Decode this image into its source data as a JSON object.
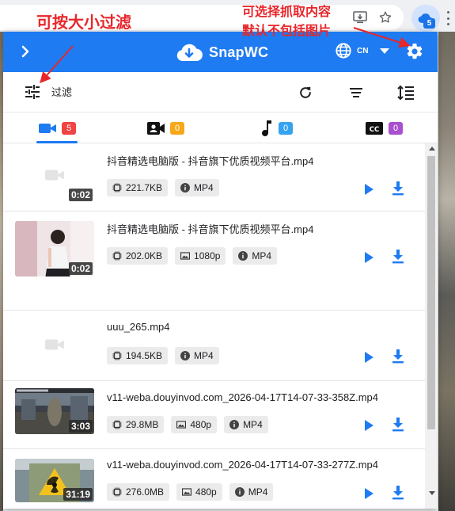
{
  "annotations": {
    "filter_note": "可按大小过滤",
    "settings_note_line1": "可选择抓取内容",
    "settings_note_line2": "默认不包括图片"
  },
  "extension_badge": "5",
  "header": {
    "app_name": "SnapWC",
    "language": "CN",
    "brand_color": "#1e7bf2"
  },
  "toolbar": {
    "filter_label": "过滤"
  },
  "tabs": [
    {
      "name": "video",
      "icon": "video-camera-icon",
      "count": "5",
      "badge_color": "#f04343"
    },
    {
      "name": "live",
      "icon": "live-camera-icon",
      "count": "0",
      "badge_color": "#f7a818"
    },
    {
      "name": "audio",
      "icon": "music-note-icon",
      "count": "0",
      "badge_color": "#35a3f0"
    },
    {
      "name": "subtitle",
      "icon": "closed-caption-icon",
      "count": "0",
      "badge_color": "#a94fd0"
    }
  ],
  "items": [
    {
      "filename": "抖音精选电脑版 - 抖音旗下优质视频平台.mp4",
      "duration": "0:02",
      "size": "221.7KB",
      "resolution": "",
      "format": "MP4",
      "thumbnail": "empty"
    },
    {
      "filename": "抖音精选电脑版 - 抖音旗下优质视频平台.mp4",
      "duration": "0:02",
      "size": "202.0KB",
      "resolution": "1080p",
      "format": "MP4",
      "thumbnail": "girl"
    },
    {
      "filename": "uuu_265.mp4",
      "duration": "",
      "size": "194.5KB",
      "resolution": "",
      "format": "MP4",
      "thumbnail": "empty"
    },
    {
      "filename": "v11-weba.douyinvod.com_2026-04-17T14-07-33-358Z.mp4",
      "duration": "3:03",
      "size": "29.8MB",
      "resolution": "480p",
      "format": "MP4",
      "thumbnail": "game"
    },
    {
      "filename": "v11-weba.douyinvod.com_2026-04-17T14-07-33-277Z.mp4",
      "duration": "31:19",
      "size": "276.0MB",
      "resolution": "480p",
      "format": "MP4",
      "thumbnail": "radiation"
    }
  ]
}
